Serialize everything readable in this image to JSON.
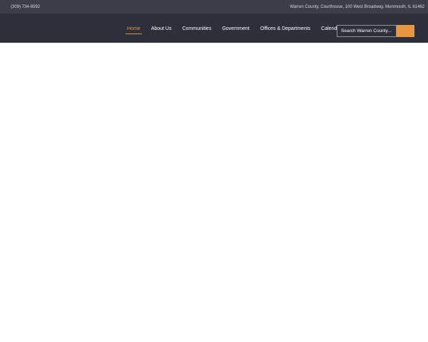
{
  "topbar": {
    "phone": "(309) 734-8592",
    "address": "Warren County, Courthouse, 100 West Broadway, Monmouth, IL 61462"
  },
  "nav": {
    "items": [
      {
        "label": "Home",
        "active": true
      },
      {
        "label": "About Us",
        "active": false
      },
      {
        "label": "Communities",
        "active": false
      },
      {
        "label": "Government",
        "active": false
      },
      {
        "label": "Offices & Departments",
        "active": false
      },
      {
        "label": "Calendar",
        "active": false
      }
    ]
  },
  "search": {
    "placeholder": "Search Warren County..."
  },
  "colors": {
    "topbar_bg": "#3b3e49",
    "navbar_bg": "#2d303b",
    "accent": "#e8963f"
  }
}
